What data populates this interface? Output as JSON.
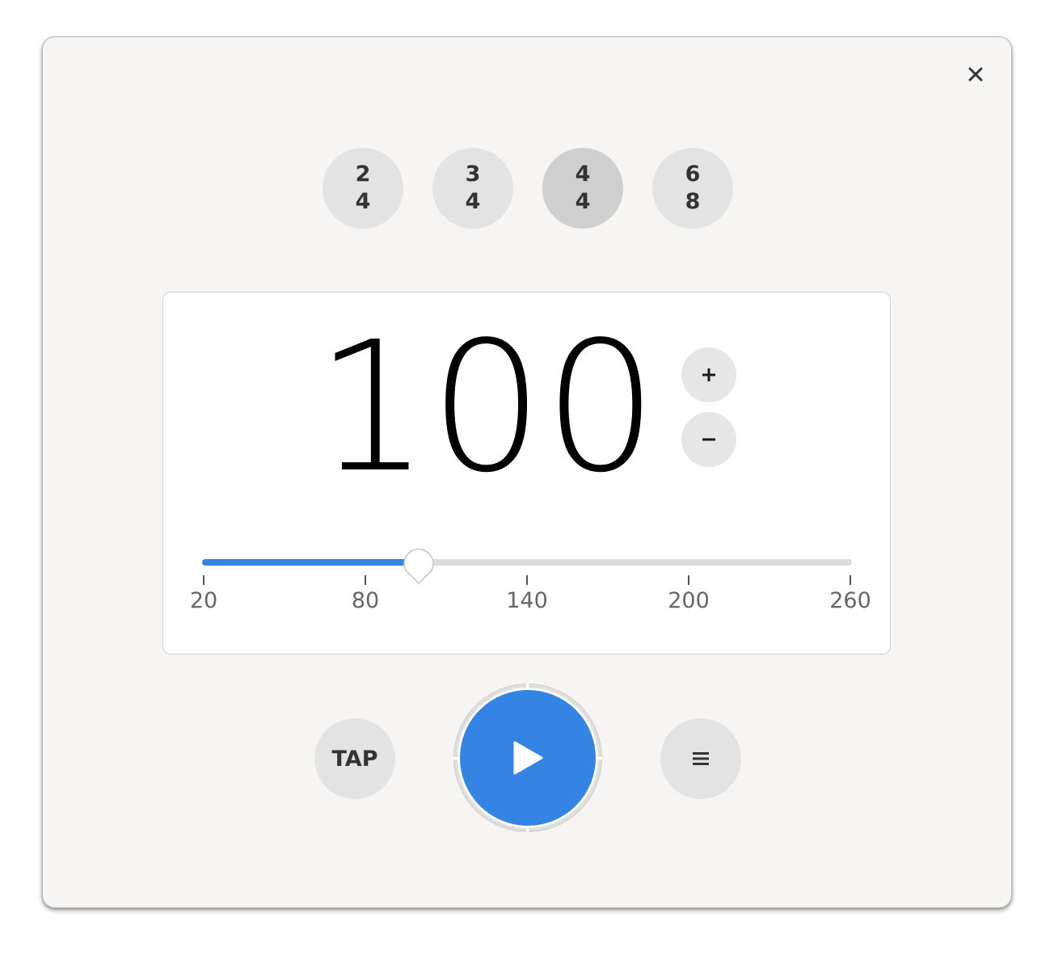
{
  "window": {
    "close_icon": "close-icon"
  },
  "time_signatures": [
    {
      "top": "2",
      "bottom": "4",
      "active": false
    },
    {
      "top": "3",
      "bottom": "4",
      "active": false
    },
    {
      "top": "4",
      "bottom": "4",
      "active": true
    },
    {
      "top": "6",
      "bottom": "8",
      "active": false
    }
  ],
  "tempo": {
    "value": "100",
    "increment_label": "+",
    "decrement_label": "−"
  },
  "slider": {
    "min": 20,
    "max": 260,
    "value": 100,
    "ticks": [
      "20",
      "80",
      "140",
      "200",
      "260"
    ]
  },
  "controls": {
    "tap_label": "TAP",
    "play_icon": "play-icon",
    "menu_icon": "menu-icon"
  },
  "colors": {
    "accent": "#3584e4",
    "background": "#f6f5f4",
    "button": "#e3e3e3",
    "button_active": "#cfcfcf"
  }
}
